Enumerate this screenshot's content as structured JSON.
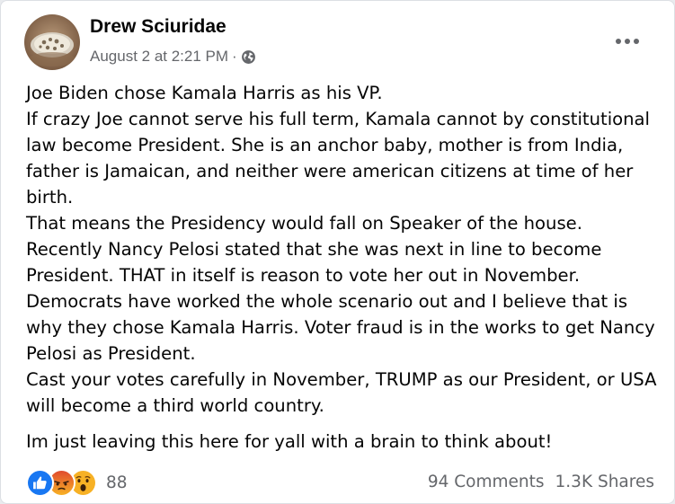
{
  "post": {
    "author": "Drew Sciuridae",
    "timestamp": "August 2 at 2:21 PM",
    "separator": "·",
    "audience_icon": "globe-icon",
    "more_icon": "more-options-icon",
    "body_lines": [
      "Joe Biden chose Kamala Harris as his VP.",
      "If crazy Joe cannot serve his full term, Kamala cannot by constitutional law become President. She is an anchor baby, mother is from India, father is Jamaican, and neither were american citizens at time of her birth.",
      "That means the Presidency would fall on Speaker of the house.",
      "Recently Nancy Pelosi stated that she was next in line to become President. THAT in itself is reason to vote her out in November.",
      "Democrats have worked the whole scenario out and I believe that is why they chose Kamala Harris. Voter fraud is in the works to get Nancy Pelosi as President.",
      "Cast your votes carefully in November, TRUMP as our President, or USA will become a third world country."
    ],
    "closing_line": "Im just leaving this here for yall with a brain to think about!"
  },
  "reactions": {
    "icons": [
      "like-reaction-icon",
      "angry-reaction-icon",
      "wow-reaction-icon"
    ],
    "count": "88",
    "colors": {
      "like": "#1877f2",
      "angry": "#e9710f",
      "wow": "#f7b125"
    }
  },
  "engagement": {
    "comments": "94 Comments",
    "shares": "1.3K Shares"
  }
}
